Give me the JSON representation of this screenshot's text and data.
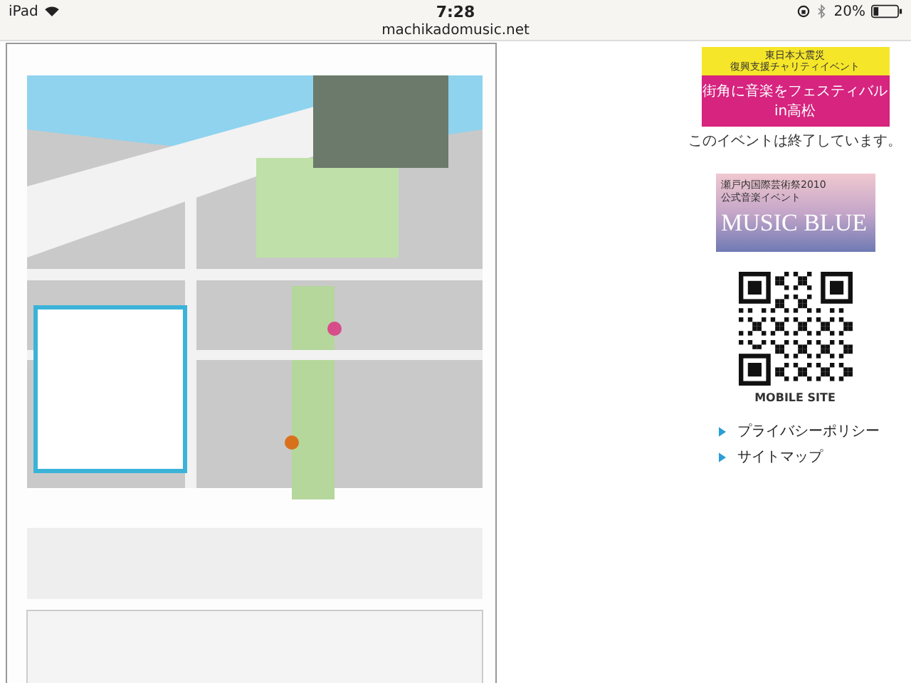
{
  "status_bar": {
    "device": "iPad",
    "time": "7:28",
    "battery": "20%"
  },
  "address_bar": {
    "url": "machikadomusic.net"
  },
  "sidebar": {
    "charity_banner": {
      "header_lines": [
        "東日本大震災",
        "復興支援チャリティイベント"
      ],
      "title": "街角に音楽をフェスティバル",
      "subtitle": "in高松"
    },
    "notice": "このイベントは終了しています。",
    "music_blue_banner": {
      "caption_lines": [
        "瀬戸内国際芸術祭2010",
        "公式音楽イベント"
      ],
      "title": "MUSIC BLUE"
    },
    "qr_label": "MOBILE SITE",
    "links": [
      {
        "label": "プライバシーポリシー"
      },
      {
        "label": "サイトマップ"
      }
    ]
  }
}
